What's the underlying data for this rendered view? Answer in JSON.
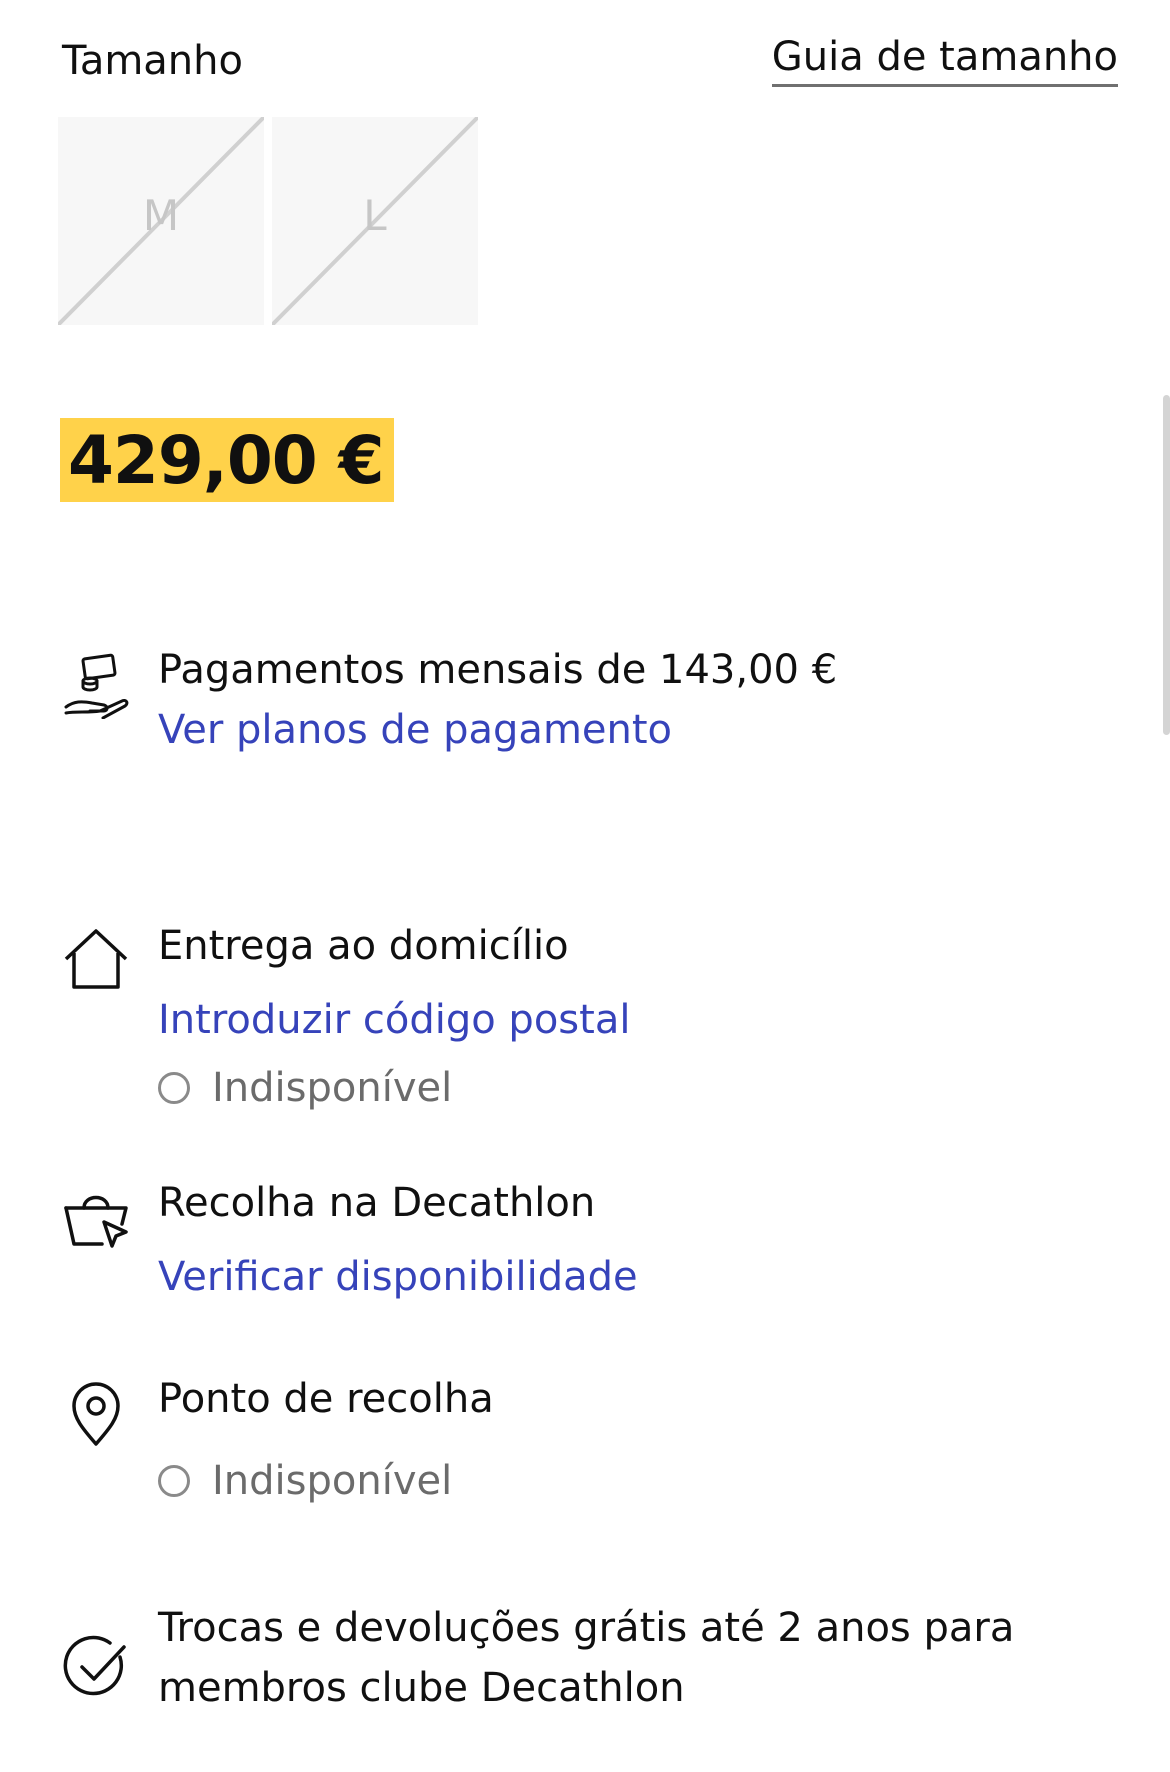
{
  "size": {
    "title": "Tamanho",
    "guide_link": "Guia de tamanho",
    "options": [
      {
        "label": "M",
        "available": false
      },
      {
        "label": "L",
        "available": false
      }
    ]
  },
  "price": {
    "value": "429,00 €",
    "highlight_color": "#ffd24a"
  },
  "payment": {
    "icon": "hand-money-icon",
    "text": "Pagamentos mensais de 143,00 €",
    "link": "Ver planos de pagamento"
  },
  "home_delivery": {
    "icon": "house-icon",
    "title": "Entrega ao domicílio",
    "link": "Introduzir código postal",
    "status": "Indisponível"
  },
  "store_pickup": {
    "icon": "basket-cursor-icon",
    "title": "Recolha na Decathlon",
    "link": "Verificar disponibilidade"
  },
  "pickup_point": {
    "icon": "location-pin-icon",
    "title": "Ponto de recolha",
    "status": "Indisponível"
  },
  "returns": {
    "icon": "check-circle-icon",
    "line1": "Trocas e devoluções grátis até 2 anos para",
    "line2": "membros clube Decathlon"
  },
  "colors": {
    "link": "#3643ba",
    "status_gray": "#6b6b6b"
  }
}
